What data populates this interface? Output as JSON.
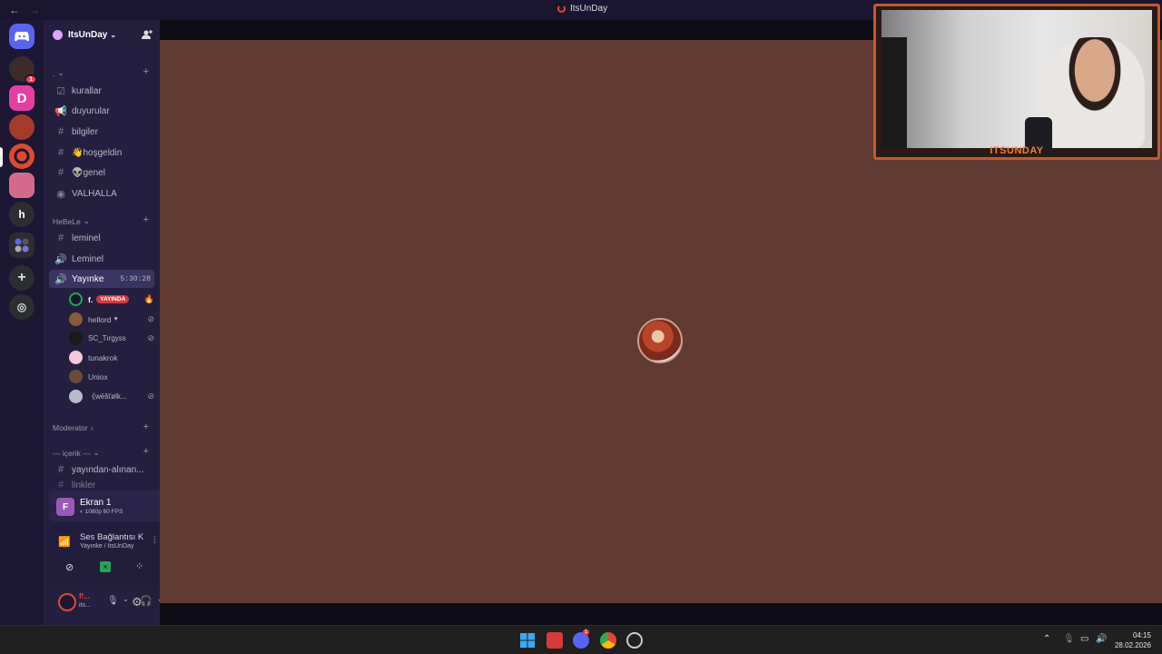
{
  "window": {
    "title": "ItsUnDay",
    "back_arrow": "←",
    "forward_arrow": "→"
  },
  "server": {
    "name": "ItsUnDay"
  },
  "categories": {
    "top": ". ",
    "hebele": "HeBeLe",
    "moderator": "Moderator",
    "icerik": "--- içerik ---"
  },
  "channels": {
    "kurallar": "kurallar",
    "duyurular": "duyurular",
    "bilgiler": "bilgiler",
    "hosgeldin": "👋hoşgeldin",
    "genel": "👽genel",
    "valhalla": "VALHALLA",
    "leminel_text": "leminel",
    "leminel_voice": "Leminel",
    "yayinke": "Yayınke",
    "yayinke_timer": "5:30:28",
    "yayindan": "yayından-alınan...",
    "linkler": "linkler"
  },
  "voice_users": [
    {
      "name": "f.",
      "badge": "YAYINDA"
    },
    {
      "name": "hellord",
      "badge": ""
    },
    {
      "name": "SC_Tırgyss",
      "badge": ""
    },
    {
      "name": "tunakrok",
      "badge": ""
    },
    {
      "name": "Uniox",
      "badge": ""
    },
    {
      "name": "《wëšťølk...",
      "badge": ""
    }
  ],
  "stream_panel": {
    "avatar_letter": "F",
    "title": "Ekran 1",
    "quality": "1080p 60 FPS"
  },
  "voice_panel": {
    "status": "Ses Bağlantısı K",
    "location": "Yayınke / ItsUnDay"
  },
  "user_panel": {
    "name": "f!...",
    "status": "its..."
  },
  "guild_letters": {
    "h": "h"
  },
  "overlay": {
    "streamer_label": "ITSUNDAY"
  },
  "taskbar": {
    "time": "04:15",
    "date": "28.02.2026",
    "discord_badge": "1"
  },
  "colors": {
    "accent": "#5865f2",
    "live": "#da373c",
    "stage_bg": "#5f3b32",
    "overlay_frame": "#c45a2a",
    "voice_green": "#23a55a"
  }
}
